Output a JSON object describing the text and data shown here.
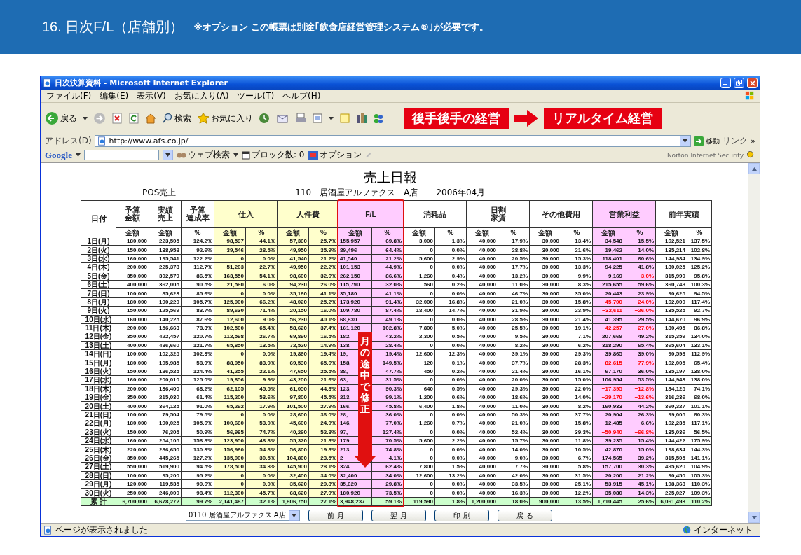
{
  "banner": {
    "title": "16. 日次F/L（店舗別）",
    "note": "※オプション この帳票は別途｢飲食店経営管理システム®｣が必要です。"
  },
  "window": {
    "title": "日次決算資料 - Microsoft Internet Explorer"
  },
  "menu": [
    "ファイル(F)",
    "編集(E)",
    "表示(V)",
    "お気に入り(A)",
    "ツール(T)",
    "ヘルプ(H)"
  ],
  "toolbar": {
    "back": "戻る",
    "search": "検索",
    "favorites": "お気に入り"
  },
  "callout": {
    "from": "後手後手の経営",
    "to": "リアルタイム経営"
  },
  "address": {
    "label": "アドレス(D)",
    "url": "http://www.afs.co.jp/",
    "go": "移動",
    "links": "リンク",
    "more": "»"
  },
  "google_bar": {
    "logo": "Google",
    "web_search": "ウェブ検索",
    "blocked": "ブロック数: 0",
    "options": "オプション",
    "norton": "Norton Internet Security"
  },
  "report": {
    "title": "売上日報",
    "source": "POS売上",
    "store": "110　居酒屋アルファクス　A店",
    "month": "2006年04月",
    "groups": [
      {
        "lines": [
          "日付"
        ],
        "color": "#ffffff",
        "highlighted": false
      },
      {
        "lines": [
          "予算",
          "金額"
        ],
        "subs": [
          "金額"
        ],
        "color": "#ffffff",
        "highlighted": false
      },
      {
        "lines": [
          "実績",
          "売上"
        ],
        "subs": [
          "金額"
        ],
        "color": "#ffffff",
        "highlighted": false
      },
      {
        "lines": [
          "予算",
          "達成率"
        ],
        "subs": [
          "%"
        ],
        "color": "#ffffff",
        "highlighted": false
      },
      {
        "lines": [
          "仕入"
        ],
        "subs": [
          "金額",
          "%"
        ],
        "color": "#ffffcc",
        "highlighted": false
      },
      {
        "lines": [
          "人件費"
        ],
        "subs": [
          "金額",
          "%"
        ],
        "color": "#ffffcc",
        "highlighted": false
      },
      {
        "lines": [
          "F/L"
        ],
        "subs": [
          "金額",
          "%"
        ],
        "color": "#ffccff",
        "highlighted": true
      },
      {
        "lines": [
          "消耗品"
        ],
        "subs": [
          "金額",
          "%"
        ],
        "color": "#ffffff",
        "highlighted": false
      },
      {
        "lines": [
          "日割",
          "家賃"
        ],
        "subs": [
          "金額",
          "%"
        ],
        "color": "#ffffff",
        "highlighted": false
      },
      {
        "lines": [
          "その他費用"
        ],
        "subs": [
          "金額",
          "%"
        ],
        "color": "#ffffff",
        "highlighted": false
      },
      {
        "lines": [
          "営業利益"
        ],
        "subs": [
          "金額",
          "%"
        ],
        "color": "#ffccff",
        "highlighted": false
      },
      {
        "lines": [
          "前年実績"
        ],
        "subs": [
          "金額",
          "%"
        ],
        "color": "#ffffff",
        "highlighted": false
      }
    ],
    "rows": [
      {
        "loss": false,
        "low_margin": false,
        "cells": [
          "1日(月)",
          "180,000",
          "223,505",
          "124.2%",
          "98,597",
          "44.1%",
          "57,360",
          "25.7%",
          "155,957",
          "69.8%",
          "3,000",
          "1.3%",
          "40,000",
          "17.9%",
          "30,000",
          "13.4%",
          "34,548",
          "15.5%",
          "162,521",
          "137.5%"
        ]
      },
      {
        "loss": false,
        "low_margin": false,
        "cells": [
          "2日(火)",
          "150,000",
          "138,958",
          "92.6%",
          "39,546",
          "28.5%",
          "49,950",
          "35.9%",
          "89,496",
          "64.4%",
          "0",
          "0.0%",
          "40,000",
          "28.8%",
          "30,000",
          "21.6%",
          "19,462",
          "14.0%",
          "135,214",
          "102.8%"
        ]
      },
      {
        "loss": false,
        "low_margin": false,
        "cells": [
          "3日(水)",
          "160,000",
          "195,541",
          "122.2%",
          "0",
          "0.0%",
          "41,540",
          "21.2%",
          "41,540",
          "21.2%",
          "5,600",
          "2.9%",
          "40,000",
          "20.5%",
          "30,000",
          "15.3%",
          "118,401",
          "60.6%",
          "144,984",
          "134.9%"
        ]
      },
      {
        "loss": false,
        "low_margin": false,
        "cells": [
          "4日(木)",
          "200,000",
          "225,378",
          "112.7%",
          "51,203",
          "22.7%",
          "49,950",
          "22.2%",
          "101,153",
          "44.9%",
          "0",
          "0.0%",
          "40,000",
          "17.7%",
          "30,000",
          "13.3%",
          "94,225",
          "41.8%",
          "180,025",
          "125.2%"
        ]
      },
      {
        "loss": false,
        "low_margin": true,
        "cells": [
          "5日(金)",
          "350,000",
          "302,579",
          "86.5%",
          "163,550",
          "54.1%",
          "98,600",
          "32.6%",
          "262,150",
          "86.6%",
          "1,260",
          "0.4%",
          "40,000",
          "13.2%",
          "30,000",
          "9.9%",
          "9,169",
          "3.0%",
          "315,990",
          "95.8%"
        ]
      },
      {
        "loss": false,
        "low_margin": false,
        "cells": [
          "6日(土)",
          "400,000",
          "362,005",
          "90.5%",
          "21,560",
          "6.0%",
          "94,230",
          "26.0%",
          "115,790",
          "32.0%",
          "560",
          "0.2%",
          "40,000",
          "11.0%",
          "30,000",
          "8.3%",
          "215,655",
          "59.6%",
          "360,748",
          "100.3%"
        ]
      },
      {
        "loss": false,
        "low_margin": false,
        "cells": [
          "7日(日)",
          "100,000",
          "85,623",
          "85.6%",
          "0",
          "0.0%",
          "35,180",
          "41.1%",
          "35,180",
          "41.1%",
          "0",
          "0.0%",
          "40,000",
          "46.7%",
          "30,000",
          "35.0%",
          "20,443",
          "23.9%",
          "90,625",
          "94.5%"
        ]
      },
      {
        "loss": true,
        "low_margin": false,
        "cells": [
          "8日(月)",
          "180,000",
          "190,220",
          "105.7%",
          "125,900",
          "66.2%",
          "48,020",
          "25.2%",
          "173,920",
          "91.4%",
          "32,000",
          "16.8%",
          "40,000",
          "21.0%",
          "30,000",
          "15.8%",
          "−45,700",
          "−24.0%",
          "162,000",
          "117.4%"
        ]
      },
      {
        "loss": true,
        "low_margin": false,
        "cells": [
          "9日(火)",
          "150,000",
          "125,569",
          "83.7%",
          "89,630",
          "71.4%",
          "20,150",
          "16.0%",
          "109,780",
          "87.4%",
          "18,400",
          "14.7%",
          "40,000",
          "31.9%",
          "30,000",
          "23.9%",
          "−32,611",
          "−26.0%",
          "135,525",
          "92.7%"
        ]
      },
      {
        "loss": false,
        "low_margin": false,
        "cells": [
          "10日(水)",
          "160,000",
          "140,225",
          "87.6%",
          "12,600",
          "9.0%",
          "56,230",
          "40.1%",
          "68,830",
          "49.1%",
          "0",
          "0.0%",
          "40,000",
          "28.5%",
          "30,000",
          "21.4%",
          "41,395",
          "29.5%",
          "144,670",
          "96.9%"
        ]
      },
      {
        "loss": true,
        "low_margin": false,
        "cells": [
          "11日(木)",
          "200,000",
          "156,663",
          "78.3%",
          "102,500",
          "65.4%",
          "58,620",
          "37.4%",
          "161,120",
          "102.8%",
          "7,800",
          "5.0%",
          "40,000",
          "25.5%",
          "30,000",
          "19.1%",
          "−42,257",
          "−27.0%",
          "180,495",
          "86.8%"
        ]
      },
      {
        "loss": false,
        "low_margin": false,
        "cells": [
          "12日(金)",
          "350,000",
          "422,457",
          "120.7%",
          "112,598",
          "26.7%",
          "69,890",
          "16.5%",
          "182,",
          "43.2%",
          "2,300",
          "0.5%",
          "40,000",
          "9.5%",
          "30,000",
          "7.1%",
          "207,669",
          "49.2%",
          "315,359",
          "134.0%"
        ]
      },
      {
        "loss": false,
        "low_margin": false,
        "cells": [
          "13日(土)",
          "400,000",
          "486,660",
          "121.7%",
          "65,850",
          "13.5%",
          "72,520",
          "14.9%",
          "138,",
          "28.4%",
          "0",
          "0.0%",
          "40,000",
          "8.2%",
          "30,000",
          "6.2%",
          "318,290",
          "65.4%",
          "365,604",
          "133.1%"
        ]
      },
      {
        "loss": false,
        "low_margin": false,
        "cells": [
          "14日(日)",
          "100,000",
          "102,325",
          "102.3%",
          "0",
          "0.0%",
          "19,860",
          "19.4%",
          "19,",
          "19.4%",
          "12,600",
          "12.3%",
          "40,000",
          "39.1%",
          "30,000",
          "29.3%",
          "39,865",
          "39.0%",
          "90,598",
          "112.9%"
        ]
      },
      {
        "loss": true,
        "low_margin": false,
        "cells": [
          "15日(月)",
          "180,000",
          "105,985",
          "58.9%",
          "88,950",
          "83.9%",
          "69,530",
          "65.6%",
          "158,",
          "149.5%",
          "120",
          "0.1%",
          "40,000",
          "37.7%",
          "30,000",
          "28.3%",
          "−82,615",
          "−77.9%",
          "162,005",
          "65.4%"
        ]
      },
      {
        "loss": false,
        "low_margin": false,
        "cells": [
          "16日(火)",
          "150,000",
          "186,525",
          "124.4%",
          "41,255",
          "22.1%",
          "47,650",
          "25.5%",
          "88,",
          "47.7%",
          "450",
          "0.2%",
          "40,000",
          "21.4%",
          "30,000",
          "16.1%",
          "67,170",
          "36.0%",
          "135,197",
          "138.0%"
        ]
      },
      {
        "loss": false,
        "low_margin": false,
        "cells": [
          "17日(水)",
          "160,000",
          "200,010",
          "125.0%",
          "19,856",
          "9.9%",
          "43,200",
          "21.6%",
          "63,",
          "31.5%",
          "0",
          "0.0%",
          "40,000",
          "20.0%",
          "30,000",
          "15.0%",
          "106,954",
          "53.5%",
          "144,943",
          "138.0%"
        ]
      },
      {
        "loss": true,
        "low_margin": false,
        "cells": [
          "18日(木)",
          "200,000",
          "136,400",
          "68.2%",
          "62,105",
          "45.5%",
          "61,050",
          "44.8%",
          "123,",
          "90.3%",
          "640",
          "0.5%",
          "40,000",
          "29.3%",
          "30,000",
          "22.0%",
          "−17,395",
          "−12.8%",
          "184,125",
          "74.1%"
        ]
      },
      {
        "loss": true,
        "low_margin": false,
        "cells": [
          "19日(金)",
          "350,000",
          "215,030",
          "61.4%",
          "115,200",
          "53.6%",
          "97,800",
          "45.5%",
          "213,",
          "99.1%",
          "1,200",
          "0.6%",
          "40,000",
          "18.6%",
          "30,000",
          "14.0%",
          "−29,170",
          "−13.6%",
          "316,236",
          "68.0%"
        ]
      },
      {
        "loss": false,
        "low_margin": false,
        "cells": [
          "20日(土)",
          "400,000",
          "364,125",
          "91.0%",
          "65,292",
          "17.9%",
          "101,500",
          "27.9%",
          "166,",
          "45.8%",
          "6,400",
          "1.8%",
          "40,000",
          "11.0%",
          "30,000",
          "8.2%",
          "160,933",
          "44.2%",
          "360,327",
          "101.1%"
        ]
      },
      {
        "loss": false,
        "low_margin": false,
        "cells": [
          "21日(日)",
          "100,000",
          "79,504",
          "79.5%",
          "0",
          "0.0%",
          "28,600",
          "36.0%",
          "28,",
          "36.0%",
          "0",
          "0.0%",
          "40,000",
          "50.3%",
          "30,000",
          "37.7%",
          "20,904",
          "26.3%",
          "99,005",
          "80.3%"
        ]
      },
      {
        "loss": false,
        "low_margin": false,
        "cells": [
          "22日(月)",
          "180,000",
          "190,025",
          "105.6%",
          "100,680",
          "53.0%",
          "45,600",
          "24.0%",
          "146,",
          "77.0%",
          "1,260",
          "0.7%",
          "40,000",
          "21.0%",
          "30,000",
          "15.8%",
          "12,485",
          "6.6%",
          "162,235",
          "117.1%"
        ]
      },
      {
        "loss": true,
        "low_margin": false,
        "cells": [
          "23日(火)",
          "150,000",
          "76,305",
          "50.9%",
          "56,985",
          "74.7%",
          "40,260",
          "52.8%",
          "97,",
          "127.4%",
          "0",
          "0.0%",
          "40,000",
          "52.4%",
          "30,000",
          "39.3%",
          "−50,940",
          "−66.8%",
          "135,036",
          "56.5%"
        ]
      },
      {
        "loss": false,
        "low_margin": false,
        "cells": [
          "24日(水)",
          "160,000",
          "254,105",
          "158.8%",
          "123,950",
          "48.8%",
          "55,320",
          "21.8%",
          "179,",
          "70.5%",
          "5,600",
          "2.2%",
          "40,000",
          "15.7%",
          "30,000",
          "11.8%",
          "39,235",
          "15.4%",
          "144,422",
          "175.9%"
        ]
      },
      {
        "loss": false,
        "low_margin": false,
        "cells": [
          "25日(木)",
          "220,000",
          "286,650",
          "130.3%",
          "156,980",
          "54.8%",
          "56,800",
          "19.8%",
          "213,",
          "74.8%",
          "0",
          "0.0%",
          "40,000",
          "14.0%",
          "30,000",
          "10.5%",
          "42,870",
          "15.0%",
          "198,634",
          "144.3%"
        ]
      },
      {
        "loss": false,
        "low_margin": false,
        "cells": [
          "26日(金)",
          "350,000",
          "445,265",
          "127.2%",
          "135,900",
          "30.5%",
          "104,800",
          "23.5%",
          "2",
          "4.1%",
          "0",
          "0.0%",
          "40,000",
          "9.0%",
          "30,000",
          "6.7%",
          "174,565",
          "39.2%",
          "315,505",
          "141.1%"
        ]
      },
      {
        "loss": false,
        "low_margin": false,
        "cells": [
          "27日(土)",
          "550,000",
          "519,900",
          "94.5%",
          "178,500",
          "34.3%",
          "145,900",
          "28.1%",
          "324,",
          "62.4%",
          "7,800",
          "1.5%",
          "40,000",
          "7.7%",
          "30,000",
          "5.8%",
          "157,700",
          "30.3%",
          "495,620",
          "104.9%"
        ]
      },
      {
        "loss": false,
        "low_margin": false,
        "cells": [
          "28日(日)",
          "100,000",
          "95,200",
          "95.2%",
          "0",
          "0.0%",
          "32,400",
          "34.0%",
          "32,400",
          "34.0%",
          "12,600",
          "13.2%",
          "40,000",
          "42.0%",
          "30,000",
          "31.5%",
          "20,200",
          "21.2%",
          "90,450",
          "105.3%"
        ]
      },
      {
        "loss": false,
        "low_margin": false,
        "cells": [
          "29日(月)",
          "120,000",
          "119,535",
          "99.6%",
          "0",
          "0.0%",
          "35,620",
          "29.8%",
          "35,620",
          "29.8%",
          "0",
          "0.0%",
          "40,000",
          "33.5%",
          "30,000",
          "25.1%",
          "53,915",
          "45.1%",
          "108,368",
          "110.3%"
        ]
      },
      {
        "loss": false,
        "low_margin": false,
        "cells": [
          "30日(火)",
          "250,000",
          "246,000",
          "98.4%",
          "112,300",
          "45.7%",
          "68,620",
          "27.9%",
          "180,920",
          "73.5%",
          "0",
          "0.0%",
          "40,000",
          "16.3%",
          "30,000",
          "12.2%",
          "35,080",
          "14.3%",
          "225,027",
          "109.3%"
        ]
      }
    ],
    "total": [
      "累 計",
      "6,700,000",
      "6,678,272",
      "99.7%",
      "2,141,487",
      "32.1%",
      "1,806,750",
      "27.1%",
      "3,948,237",
      "59.1%",
      "119,590",
      "1.8%",
      "1,200,000",
      "18.0%",
      "900,000",
      "13.5%",
      "1,710,445",
      "25.6%",
      "6,061,493",
      "110.2%"
    ]
  },
  "annotation": {
    "text": "月の途中で修正"
  },
  "controls": {
    "store_select": "0110 居酒屋アルファクス A店",
    "buttons": [
      "前 月",
      "翌 月",
      "印 刷",
      "戻 る"
    ]
  },
  "status_bar": {
    "message": "ページが表示されました",
    "zone": "インターネット"
  }
}
